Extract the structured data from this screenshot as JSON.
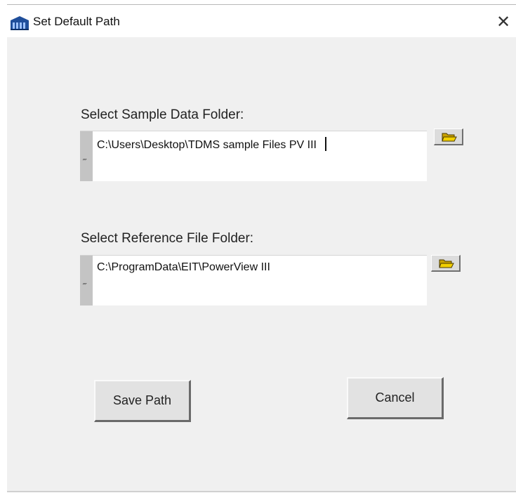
{
  "window": {
    "title": "Set Default Path",
    "icon": "app-building-icon",
    "close_glyph": "✕"
  },
  "sample_folder": {
    "label": "Select Sample Data Folder:",
    "value": "C:\\Users\\Desktop\\TDMS sample Files PV III",
    "browse_icon": "folder-open-icon"
  },
  "reference_folder": {
    "label": "Select Reference File Folder:",
    "value": "C:\\ProgramData\\EIT\\PowerView III",
    "browse_icon": "folder-open-icon"
  },
  "buttons": {
    "save_label": "Save Path",
    "cancel_label": "Cancel"
  },
  "colors": {
    "client_bg": "#f0f0f0",
    "folder_icon": "#d9b300"
  }
}
